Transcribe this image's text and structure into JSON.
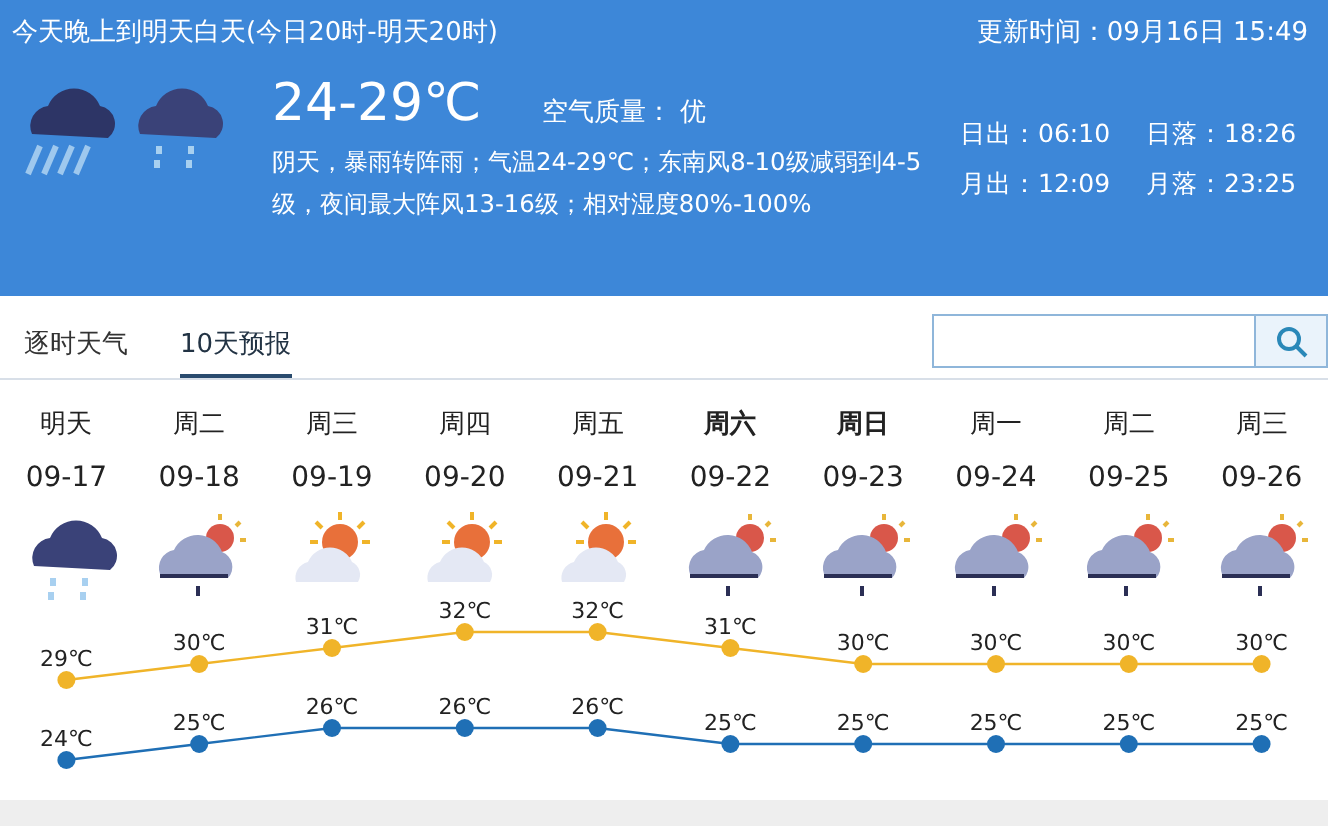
{
  "header": {
    "title": "今天晚上到明天白天(今日20时-明天20时)",
    "updated": "更新时间：09月16日 15:49",
    "icons": [
      {
        "kind": "heavy-rain"
      },
      {
        "kind": "rain"
      }
    ],
    "temperature": "24-29℃",
    "air_quality": {
      "label": "空气质量：",
      "value": "优"
    },
    "description": "阴天，暴雨转阵雨；气温24-29℃；东南风8-10级减弱到4-5级，夜间最大阵风13-16级；相对湿度80%-100%",
    "sun_moon": [
      {
        "label": "日出：06:10"
      },
      {
        "label": "日落：18:26"
      },
      {
        "label": "月出：12:09"
      },
      {
        "label": "月落：23:25"
      }
    ]
  },
  "tabs": [
    {
      "label": "逐时天气",
      "selected": false
    },
    {
      "label": "10天预报",
      "selected": true
    }
  ],
  "days": [
    {
      "weekday": "明天",
      "weekend": false,
      "date": "09-17",
      "kind": "rain"
    },
    {
      "weekday": "周二",
      "weekend": false,
      "date": "09-18",
      "kind": "sun-cloud-rain"
    },
    {
      "weekday": "周三",
      "weekend": false,
      "date": "09-19",
      "kind": "sun-cloud"
    },
    {
      "weekday": "周四",
      "weekend": false,
      "date": "09-20",
      "kind": "sun-cloud"
    },
    {
      "weekday": "周五",
      "weekend": false,
      "date": "09-21",
      "kind": "sun-cloud"
    },
    {
      "weekday": "周六",
      "weekend": true,
      "date": "09-22",
      "kind": "sun-cloud-rain"
    },
    {
      "weekday": "周日",
      "weekend": true,
      "date": "09-23",
      "kind": "sun-cloud-rain"
    },
    {
      "weekday": "周一",
      "weekend": false,
      "date": "09-24",
      "kind": "sun-cloud-rain"
    },
    {
      "weekday": "周二",
      "weekend": false,
      "date": "09-25",
      "kind": "sun-cloud-rain"
    },
    {
      "weekday": "周三",
      "weekend": false,
      "date": "09-26",
      "kind": "sun-cloud-rain"
    }
  ],
  "chart_data": {
    "type": "line",
    "data_labels": true,
    "series": [
      {
        "marker": "circle",
        "color": "#f0b429",
        "values": [
          29,
          30,
          31,
          32,
          32,
          31,
          30,
          30,
          30,
          30
        ],
        "value_labels": [
          "29℃",
          "30℃",
          "31℃",
          "32℃",
          "32℃",
          "31℃",
          "30℃",
          "30℃",
          "30℃",
          "30℃"
        ]
      },
      {
        "marker": "circle",
        "color": "#1f6fb5",
        "values": [
          24,
          25,
          26,
          26,
          26,
          25,
          25,
          25,
          25,
          25
        ],
        "value_labels": [
          "24℃",
          "25℃",
          "26℃",
          "26℃",
          "26℃",
          "25℃",
          "25℃",
          "25℃",
          "25℃",
          "25℃"
        ]
      }
    ]
  }
}
